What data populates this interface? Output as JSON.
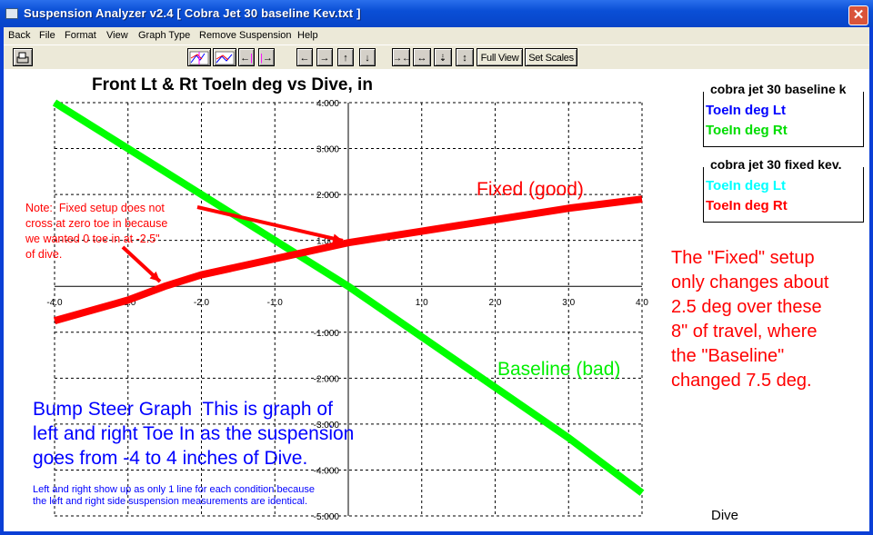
{
  "window": {
    "title": "Suspension Analyzer v2.4  [ Cobra Jet 30 baseline Kev.txt ]",
    "close_icon": "close-icon"
  },
  "menu": [
    "Back",
    "File",
    "Format",
    "View",
    "Graph Type",
    "Remove Suspension",
    "Help"
  ],
  "toolbar": {
    "print_icon": "printer-icon",
    "buttons": [
      "graph-options-icon",
      "graph-icon",
      "cursor-left-icon",
      "cursor-right-icon",
      "pan-left-icon",
      "pan-right-icon",
      "pan-up-icon",
      "pan-down-icon",
      "zoom-in-horizontal-icon",
      "zoom-out-horizontal-icon",
      "zoom-in-vertical-icon",
      "zoom-out-vertical-icon"
    ],
    "full_view": "Full View",
    "set_scales": "Set Scales"
  },
  "legends": [
    {
      "title": "cobra jet 30 baseline k",
      "items": [
        {
          "label": "ToeIn deg Lt",
          "color": "#0000ff"
        },
        {
          "label": "ToeIn deg Rt",
          "color": "#00ff00"
        }
      ]
    },
    {
      "title": "cobra jet 30 fixed kev.",
      "items": [
        {
          "label": "ToeIn deg Lt",
          "color": "#00ffff"
        },
        {
          "label": "ToeIn deg Rt",
          "color": "#ff0000"
        }
      ]
    }
  ],
  "annotations": {
    "note": "Note:  Fixed setup does not\ncross at zero toe in because\nwe wanted 0 toe in at -2.5\"\nof dive.",
    "fixed_label": "Fixed (good)",
    "baseline_label": "Baseline (bad)",
    "right_text": "The \"Fixed\" setup\nonly changes about\n2.5 deg over these\n8\" of travel, where\nthe \"Baseline\"\nchanged 7.5 deg.",
    "bump_title": "Bump Steer Graph  This is graph of\nleft and right Toe In as the suspension\ngoes from -4 to 4 inches of Dive.",
    "bump_sub": "Left and right show up as only 1 line for each condition because\nthe left and right side suspension measurements are identical.",
    "colors": {
      "red": "#ff0000",
      "green": "#00ff00",
      "blue": "#0000ff"
    }
  },
  "chart_data": {
    "type": "line",
    "title": "Front Lt & Rt ToeIn deg vs Dive, in",
    "xlabel": "Dive",
    "ylabel": "",
    "xlim": [
      -4,
      4
    ],
    "ylim": [
      -5,
      4
    ],
    "xticks": [
      -4,
      -3,
      -2,
      -1,
      0,
      1,
      2,
      3,
      4
    ],
    "xtick_labels": [
      "-4.0",
      "-3.0",
      "-2.0",
      "-1.0",
      "",
      "1.0",
      "2.0",
      "3.0",
      "4.0"
    ],
    "yticks": [
      4,
      3,
      2,
      1,
      0,
      -1,
      -2,
      -3,
      -4,
      -5
    ],
    "ytick_labels": [
      "4.000",
      "3.000",
      "2.000",
      "1.000",
      "",
      "-1.000",
      "-2.000",
      "-3.000",
      "-4.000",
      "-5.000"
    ],
    "grid": true,
    "series": [
      {
        "name": "Baseline ToeIn deg Rt",
        "color": "#00ff00",
        "x": [
          -4,
          -3,
          -2,
          -1,
          0,
          1,
          2,
          3,
          4
        ],
        "y": [
          4.0,
          3.0,
          2.0,
          1.0,
          0.0,
          -1.1,
          -2.2,
          -3.3,
          -4.5
        ]
      },
      {
        "name": "Fixed ToeIn deg Rt",
        "color": "#ff0000",
        "x": [
          -4,
          -3,
          -2.5,
          -2,
          -1,
          0,
          1,
          2,
          3,
          4
        ],
        "y": [
          -0.75,
          -0.3,
          0.0,
          0.25,
          0.6,
          0.95,
          1.2,
          1.45,
          1.7,
          1.9
        ]
      }
    ]
  }
}
